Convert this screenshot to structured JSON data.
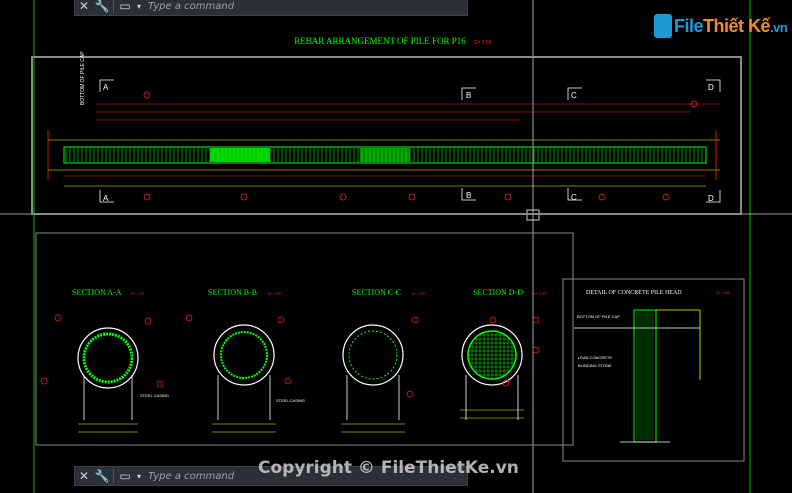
{
  "command_line": {
    "placeholder": "Type a command"
  },
  "logo": {
    "part1": "File",
    "part2": "Thiết Kế",
    "part3": ".vn"
  },
  "watermark": "Copyright © FileThietKe.vn",
  "drawing": {
    "main_title": "REBAR ARRANGEMENT OF PILE FOR P16",
    "main_scale": "S= 1:50",
    "side_label": "BOTTOM OF PILE CAP",
    "section_markers": [
      "A",
      "A",
      "B",
      "B",
      "C",
      "C",
      "D",
      "D"
    ],
    "sections": [
      {
        "title": "SECTION A-A",
        "scale": "S= 1:50",
        "note": "STEEL CASING"
      },
      {
        "title": "SECTION B-B",
        "scale": "S= 1:50",
        "note": "STEEL CASING"
      },
      {
        "title": "SECTION C-C",
        "scale": "S= 1:50",
        "note": ""
      },
      {
        "title": "SECTION D-D",
        "scale": "S= 1:50",
        "note": ""
      }
    ],
    "detail": {
      "title": "DETAIL OF CONCRETE PILE HEAD",
      "scale": "S= 1:50",
      "label1": "BOTTOM OF PILE CAP",
      "label2": "LEAN CONCRETE",
      "label3": "BLINDING STONE"
    }
  },
  "colors": {
    "bg": "#000000",
    "green": "#00ff00",
    "frame": "#8a8a8a",
    "red": "#ff2020",
    "cyan": "#00e5ff",
    "yellow": "#ffff00",
    "white": "#ffffff"
  }
}
